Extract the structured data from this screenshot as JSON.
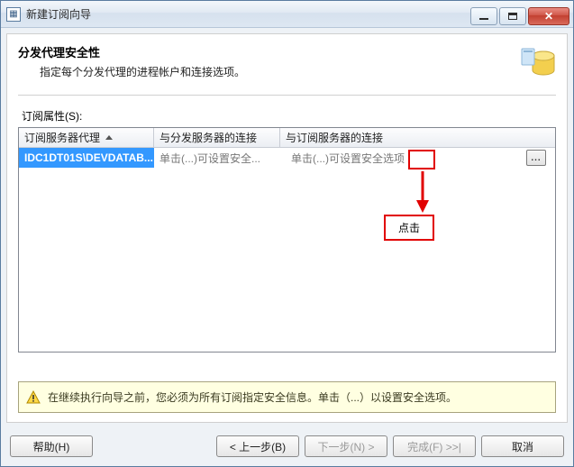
{
  "window": {
    "title": "新建订阅向导"
  },
  "header": {
    "title": "分发代理安全性",
    "subtitle": "指定每个分发代理的进程帐户和连接选项。"
  },
  "section_label": "订阅属性(S):",
  "columns": {
    "agent": "订阅服务器代理",
    "dist_conn": "与分发服务器的连接",
    "sub_conn": "与订阅服务器的连接"
  },
  "rows": [
    {
      "agent": "IDC1DT01S\\DEVDATAB...",
      "dist_conn": "单击(...)可设置安全...",
      "sub_conn": "单击(...)可设置安全选项"
    }
  ],
  "ellipsis_label": "...",
  "annotation": {
    "callout": "点击"
  },
  "warning": "在继续执行向导之前，您必须为所有订阅指定安全信息。单击（...）以设置安全选项。",
  "buttons": {
    "help": "帮助(H)",
    "back": "< 上一步(B)",
    "next": "下一步(N) >",
    "finish": "完成(F) >>|",
    "cancel": "取消"
  }
}
